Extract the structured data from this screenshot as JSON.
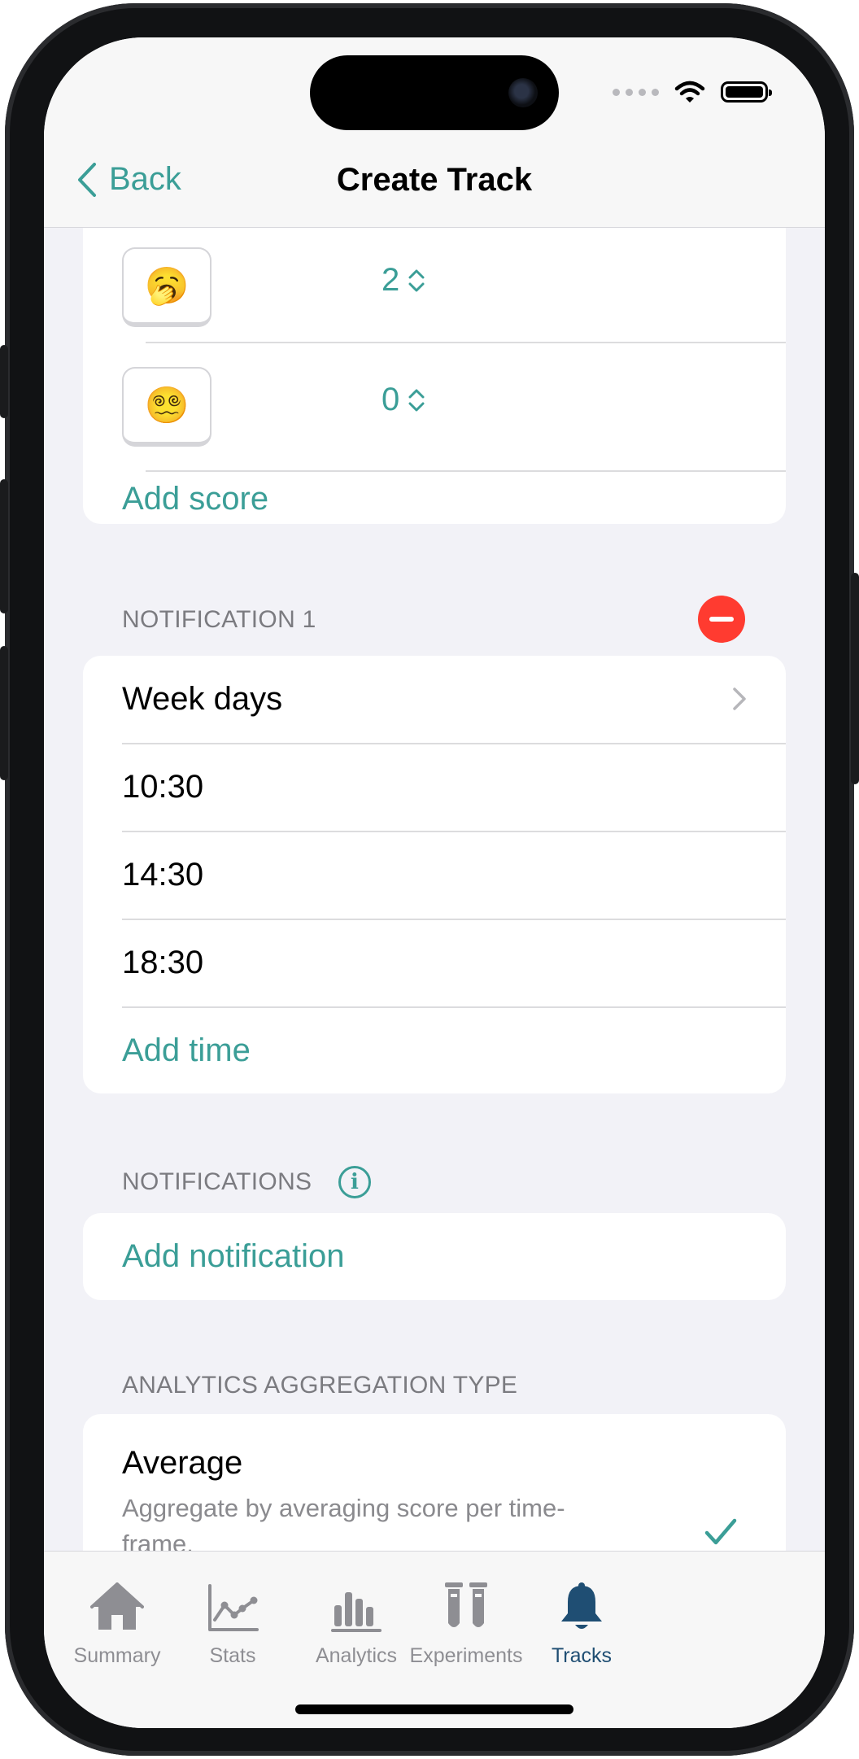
{
  "nav": {
    "back_label": "Back",
    "title": "Create Track"
  },
  "scores": {
    "items": [
      {
        "emoji": "🥱",
        "value": "2"
      },
      {
        "emoji": "😵‍💫",
        "value": "0"
      }
    ],
    "add_label": "Add score"
  },
  "notification1": {
    "header": "NOTIFICATION 1",
    "days_label": "Week days",
    "times": [
      "10:30",
      "14:30",
      "18:30"
    ],
    "add_time_label": "Add time"
  },
  "notifications": {
    "header": "NOTIFICATIONS",
    "add_label": "Add notification"
  },
  "aggregation": {
    "header": "ANALYTICS AGGREGATION TYPE",
    "option_title": "Average",
    "option_description": "Aggregate by averaging score per time-frame."
  },
  "tabbar": {
    "items": [
      {
        "label": "Summary",
        "icon": "house-icon"
      },
      {
        "label": "Stats",
        "icon": "line-chart-icon"
      },
      {
        "label": "Analytics",
        "icon": "bar-chart-icon"
      },
      {
        "label": "Experiments",
        "icon": "test-tubes-icon"
      },
      {
        "label": "Tracks",
        "icon": "bell-icon"
      }
    ],
    "active": "Tracks"
  },
  "colors": {
    "accent": "#3b9e97",
    "destructive": "#ff3b30",
    "tab_active": "#1f4e73",
    "tab_inactive": "#8e8e93"
  }
}
